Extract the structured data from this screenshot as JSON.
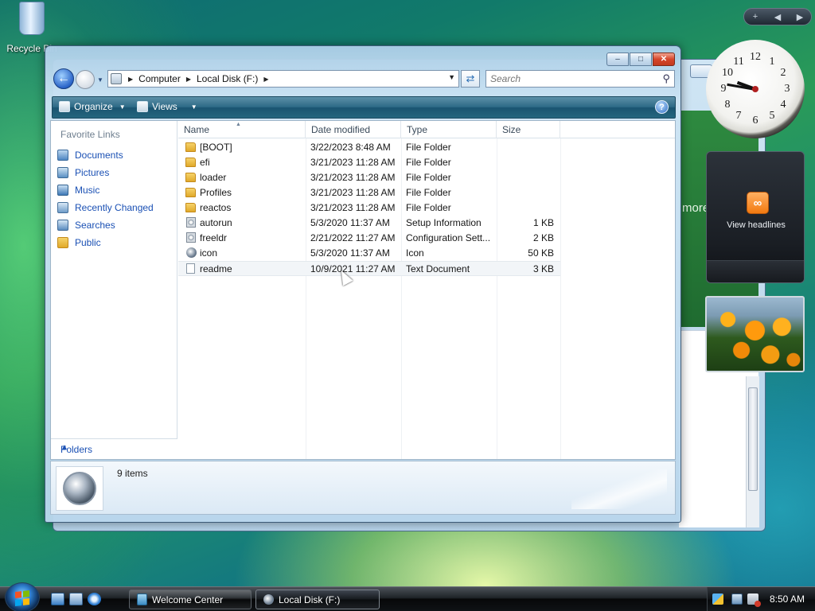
{
  "desktop": {
    "recycle_bin_label": "Recycle Bin"
  },
  "background_window": {
    "visible_text": "more"
  },
  "window": {
    "caption_buttons": {
      "minimize": "–",
      "maximize": "□",
      "close": "✕"
    },
    "address": {
      "crumbs": [
        "Computer",
        "Local Disk (F:)"
      ]
    },
    "search": {
      "placeholder": "Search"
    },
    "command_bar": {
      "organize": "Organize",
      "views": "Views",
      "help": "?"
    },
    "nav_pane": {
      "favorite_links_title": "Favorite Links",
      "links": [
        {
          "label": "Documents",
          "icon": "documents-icon"
        },
        {
          "label": "Pictures",
          "icon": "pictures-icon"
        },
        {
          "label": "Music",
          "icon": "music-icon"
        },
        {
          "label": "Recently Changed",
          "icon": "recently-changed-icon"
        },
        {
          "label": "Searches",
          "icon": "searches-icon"
        },
        {
          "label": "Public",
          "icon": "public-folder-icon"
        }
      ],
      "folders_label": "Folders"
    },
    "file_list": {
      "columns": [
        "Name",
        "Date modified",
        "Type",
        "Size"
      ],
      "rows": [
        {
          "name": "[BOOT]",
          "date": "3/22/2023 8:48 AM",
          "type": "File Folder",
          "size": "",
          "icon": "folder-icon"
        },
        {
          "name": "efi",
          "date": "3/21/2023 11:28 AM",
          "type": "File Folder",
          "size": "",
          "icon": "folder-icon"
        },
        {
          "name": "loader",
          "date": "3/21/2023 11:28 AM",
          "type": "File Folder",
          "size": "",
          "icon": "folder-icon"
        },
        {
          "name": "Profiles",
          "date": "3/21/2023 11:28 AM",
          "type": "File Folder",
          "size": "",
          "icon": "folder-icon"
        },
        {
          "name": "reactos",
          "date": "3/21/2023 11:28 AM",
          "type": "File Folder",
          "size": "",
          "icon": "folder-icon"
        },
        {
          "name": "autorun",
          "date": "5/3/2020 11:37 AM",
          "type": "Setup Information",
          "size": "1 KB",
          "icon": "setup-info-icon"
        },
        {
          "name": "freeldr",
          "date": "2/21/2022 11:27 AM",
          "type": "Configuration Sett...",
          "size": "2 KB",
          "icon": "config-file-icon"
        },
        {
          "name": "icon",
          "date": "5/3/2020 11:37 AM",
          "type": "Icon",
          "size": "50 KB",
          "icon": "icon-file-icon"
        },
        {
          "name": "readme",
          "date": "10/9/2021 11:27 AM",
          "type": "Text Document",
          "size": "3 KB",
          "icon": "text-document-icon"
        }
      ]
    },
    "details_pane": {
      "item_count": "9 items"
    }
  },
  "gadgets": {
    "sidebar_controls": [
      "+",
      "◀",
      "▶"
    ],
    "clock": {
      "numerals": [
        "12",
        "1",
        "2",
        "3",
        "4",
        "5",
        "6",
        "7",
        "8",
        "9",
        "10",
        "11"
      ]
    },
    "feed": {
      "label": "View headlines"
    }
  },
  "taskbar": {
    "tasks": [
      {
        "label": "Welcome Center",
        "active": false
      },
      {
        "label": "Local Disk (F:)",
        "active": true
      }
    ],
    "clock": "8:50 AM"
  },
  "colors": {
    "link_blue": "#1a50b4",
    "command_bar": "#2d6a86",
    "close_red": "#d5452a"
  }
}
